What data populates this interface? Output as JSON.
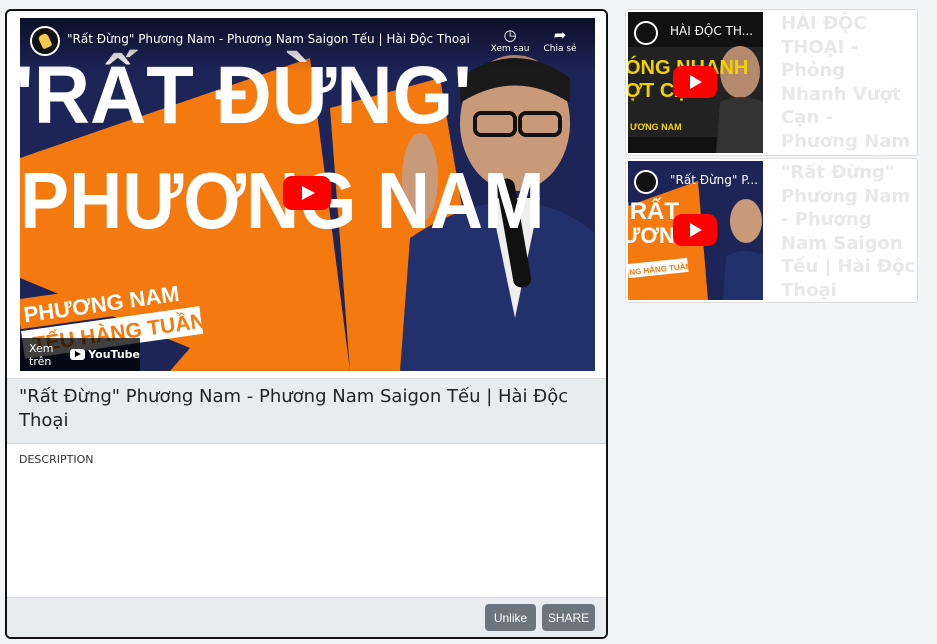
{
  "main_video": {
    "title": "\"Rất Đừng\" Phương Nam - Phương Nam Saigon Tếu | Hài Độc Thoại",
    "player_title": "\"Rất Đừng\" Phương Nam - Phương Nam Saigon Tếu | Hài Độc Thoại",
    "watch_later": "Xem sau",
    "share": "Chia sẻ",
    "watch_on": "Xem trên",
    "youtube": "YouTube",
    "thumb_text_1": "'RẤT ĐỪNG'",
    "thumb_text_2": "PHƯƠNG NAM",
    "thumb_badge_1": "PHƯƠNG NAM",
    "thumb_badge_2": "TẾU HÀNG TUẦN"
  },
  "description_label": "DESCRIPTION",
  "footer": {
    "unlike_label": "Unlike",
    "share_label": "SHARE"
  },
  "side_videos": [
    {
      "player_title": "HÀI ĐỘC TH...",
      "title": "HÀI ĐỘC THOẠI - Phỏng Nhanh Vượt Cạn - Phương Nam Saigon Tếu",
      "thumb_text_1": "ÓNG NHANH",
      "thumb_text_2": "ỢT CẠN",
      "thumb_badge": "ƯƠNG NAM"
    },
    {
      "player_title": "\"Rất Đừng\" P...",
      "title": "\"Rất Đừng\" Phương Nam - Phương Nam Saigon Tếu | Hài Độc Thoại",
      "thumb_text_1": "'RẤT",
      "thumb_text_2": "ƯƠNG N",
      "thumb_badge": "NG HÀNG TUẦN"
    }
  ],
  "colors": {
    "accent_orange": "#f47a0f",
    "navy": "#1d2457",
    "play_red": "#ff0000",
    "button_gray": "#6c757d"
  }
}
